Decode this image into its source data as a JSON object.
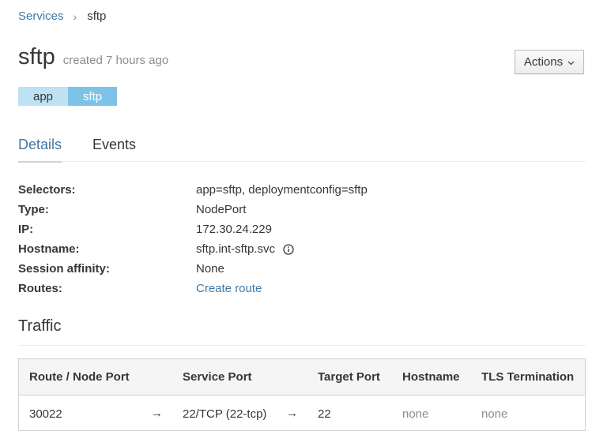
{
  "breadcrumb": {
    "parent_label": "Services",
    "separator": "›",
    "current_label": "sftp"
  },
  "header": {
    "title": "sftp",
    "created": "created 7 hours ago",
    "actions_label": "Actions"
  },
  "labels": [
    {
      "key": "app",
      "value": "sftp"
    }
  ],
  "tabs": [
    {
      "label": "Details",
      "active": true
    },
    {
      "label": "Events",
      "active": false
    }
  ],
  "details": {
    "selectors_label": "Selectors:",
    "selectors_value": "app=sftp, deploymentconfig=sftp",
    "type_label": "Type:",
    "type_value": "NodePort",
    "ip_label": "IP:",
    "ip_value": "172.30.24.229",
    "hostname_label": "Hostname:",
    "hostname_value": "sftp.int-sftp.svc",
    "session_label": "Session affinity:",
    "session_value": "None",
    "routes_label": "Routes:",
    "routes_value": "Create route"
  },
  "traffic": {
    "heading": "Traffic",
    "columns": [
      "Route / Node Port",
      "Service Port",
      "Target Port",
      "Hostname",
      "TLS Termination"
    ],
    "rows": [
      {
        "route": "30022",
        "arrow1": "→",
        "service_port": "22/TCP (22-tcp)",
        "arrow2": "→",
        "target_port": "22",
        "hostname": "none",
        "tls": "none"
      }
    ]
  },
  "colors": {
    "link": "#3f79a8",
    "label_key_bg": "#bee1f4",
    "label_value_bg": "#7dc3e8",
    "muted_text": "#8b8d8f"
  },
  "icons": {
    "breadcrumb_separator": "chevron-right-icon",
    "actions": "chevron-down-icon",
    "hostname_info": "info-circle-icon"
  }
}
